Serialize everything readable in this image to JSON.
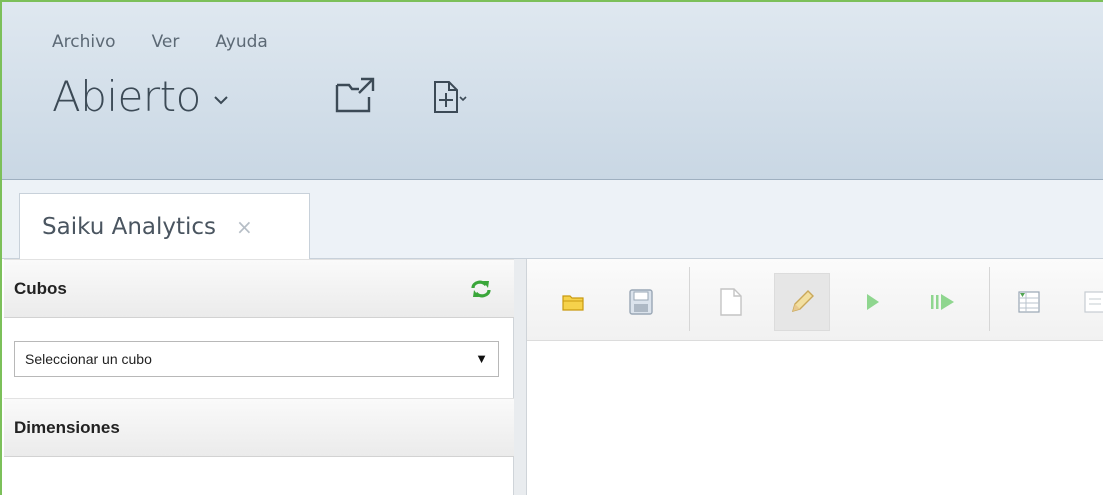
{
  "menu": [
    "Archivo",
    "Ver",
    "Ayuda"
  ],
  "perspective": {
    "label": "Abierto"
  },
  "tabs": [
    {
      "label": "Saiku Analytics",
      "close": "×"
    }
  ],
  "panels": {
    "cubes": {
      "title": "Cubos"
    },
    "cube_select": {
      "value": "Seleccionar un cubo",
      "arrow": "▼"
    },
    "dimensions": {
      "title": "Dimensiones"
    }
  },
  "colors": {
    "frame": "#7cc05a",
    "header": "#c9d7e4",
    "refresh_icon": "#3aa63a",
    "folder_icon": "#f2c21b"
  },
  "toolbar_icons": [
    "open-query-icon",
    "save-query-icon",
    "new-query-icon",
    "edit-query-icon",
    "run-query-icon",
    "automatic-execution-icon",
    "toggle-fields-icon",
    "more-icon"
  ]
}
